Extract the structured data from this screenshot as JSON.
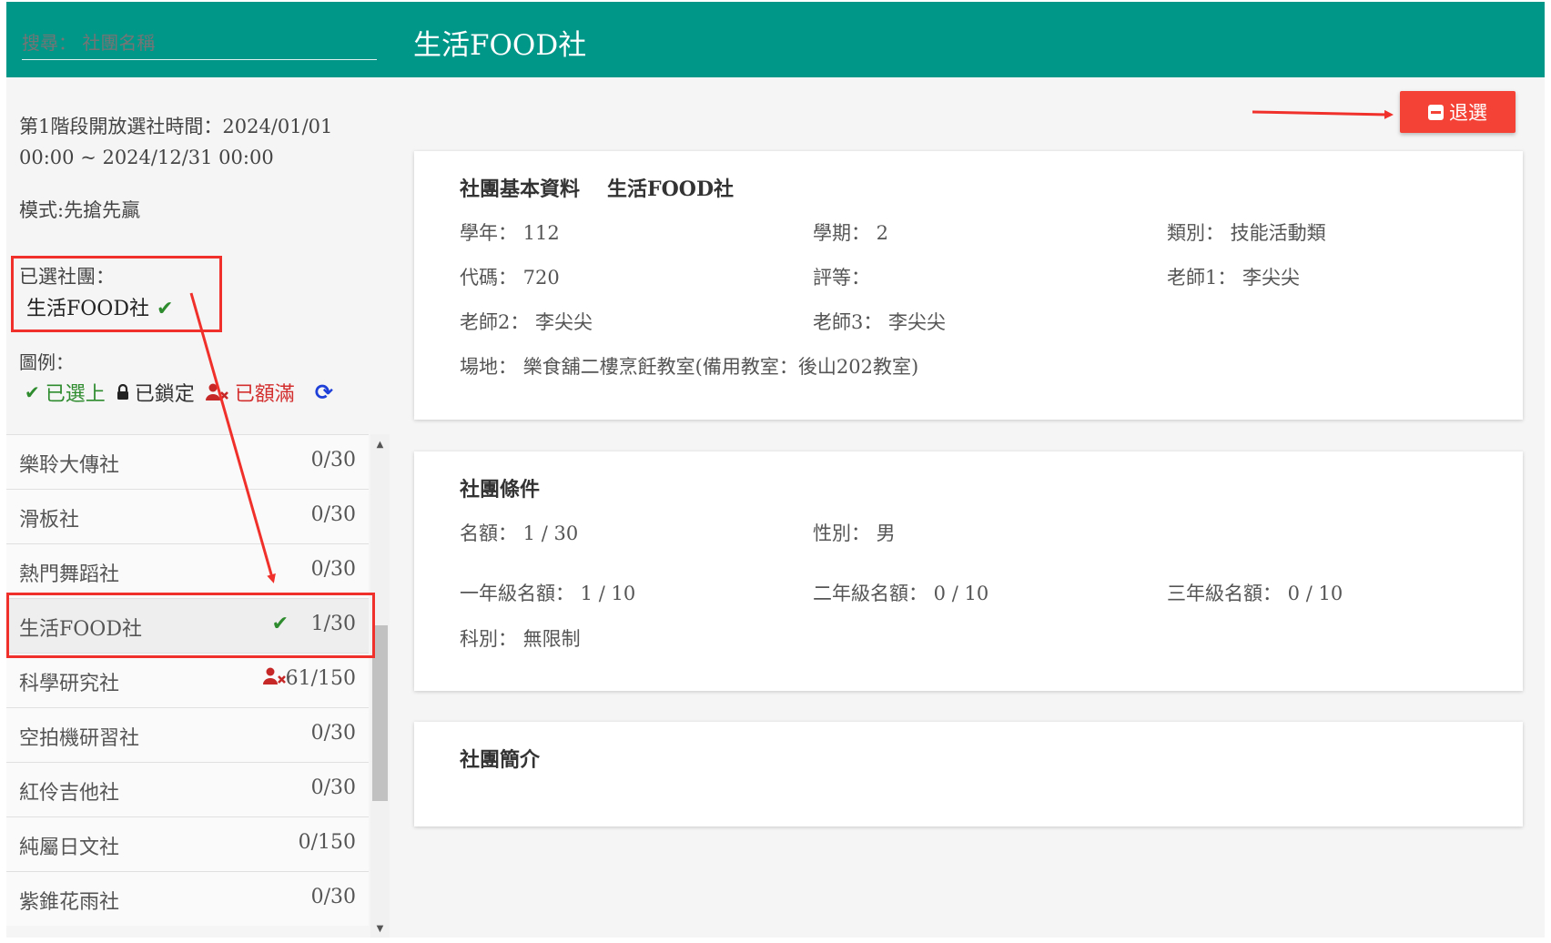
{
  "header": {
    "search_placeholder": "搜尋： 社團名稱",
    "title": "生活FOOD社"
  },
  "left": {
    "phase_text": "第1階段開放選社時間：2024/01/01 00:00 ~ 2024/12/31 00:00",
    "mode_text": "模式:先搶先贏",
    "selected_label": "已選社團：",
    "selected_club": "生活FOOD社",
    "legend_label": "圖例：",
    "legend": {
      "selected": "已選上",
      "locked": "已鎖定",
      "full": "已額滿"
    }
  },
  "clubs": [
    {
      "name": "樂聆大傳社",
      "count": "0/30",
      "status": ""
    },
    {
      "name": "滑板社",
      "count": "0/30",
      "status": ""
    },
    {
      "name": "熱門舞蹈社",
      "count": "0/30",
      "status": ""
    },
    {
      "name": "生活FOOD社",
      "count": "1/30",
      "status": "selected"
    },
    {
      "name": "科學研究社",
      "count": "61/150",
      "status": "full"
    },
    {
      "name": "空拍機研習社",
      "count": "0/30",
      "status": ""
    },
    {
      "name": "紅伶吉他社",
      "count": "0/30",
      "status": ""
    },
    {
      "name": "純屬日文社",
      "count": "0/150",
      "status": ""
    },
    {
      "name": "紫錐花雨社",
      "count": "0/30",
      "status": ""
    }
  ],
  "withdraw_label": "退選",
  "basic": {
    "title": "社團基本資料",
    "club_name": "生活FOOD社",
    "year": "學年： 112",
    "semester": "學期： 2",
    "category": "類別： 技能活動類",
    "code": "代碼： 720",
    "grade": "評等：",
    "teacher1": "老師1： 李尖尖",
    "teacher2": "老師2： 李尖尖",
    "teacher3": "老師3： 李尖尖",
    "venue": "場地： 樂食舖二樓烹飪教室(備用教室：後山202教室)"
  },
  "conditions": {
    "title": "社團條件",
    "quota": "名額： 1 / 30",
    "gender": "性別： 男",
    "grade1": "一年級名額： 1 / 10",
    "grade2": "二年級名額： 0 / 10",
    "grade3": "三年級名額： 0 / 10",
    "department": "科別： 無限制"
  },
  "intro": {
    "title": "社團簡介"
  },
  "colors": {
    "header": "#009688",
    "withdraw": "#f44336",
    "annotation": "#f0302a",
    "check": "#2e8b2e",
    "full": "#c62828"
  }
}
